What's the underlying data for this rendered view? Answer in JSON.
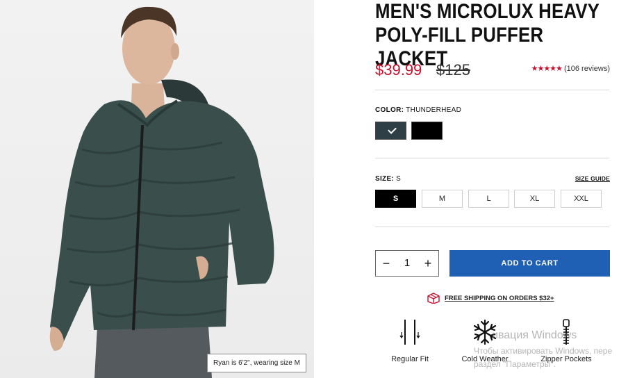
{
  "product": {
    "title": "MEN'S MICROLUX HEAVY POLY-FILL PUFFER JACKET",
    "price_sale": "$39.99",
    "price_original": "$125",
    "stars": "★★★★★",
    "reviews": "(106 reviews)"
  },
  "photo": {
    "caption": "Ryan is 6'2\", wearing size M"
  },
  "color": {
    "label": "COLOR:",
    "value": "THUNDERHEAD",
    "swatches": [
      {
        "name": "thunderhead",
        "hex": "#2f3f46",
        "selected": true
      },
      {
        "name": "black",
        "hex": "#000000",
        "selected": false
      }
    ]
  },
  "size": {
    "label": "SIZE:",
    "value": "S",
    "guide": "SIZE GUIDE",
    "options": [
      "S",
      "M",
      "L",
      "XL",
      "XXL"
    ],
    "selected": "S"
  },
  "cart": {
    "qty_minus": "−",
    "qty_value": "1",
    "qty_plus": "+",
    "add_label": "ADD TO CART"
  },
  "shipping": {
    "text": "FREE SHIPPING ON ORDERS $32+",
    "icon": "box-icon"
  },
  "features": [
    {
      "label": "Regular Fit",
      "icon": "regular-fit-icon"
    },
    {
      "label": "Cold Weather",
      "icon": "snowflake-icon"
    },
    {
      "label": "Zipper Pockets",
      "icon": "zipper-icon"
    }
  ],
  "watermark": {
    "line1": "ивация Windows",
    "line2": "Чтобы активировать Windows, пере",
    "line3": "раздел \"Параметры\"."
  },
  "colors": {
    "sale_red": "#c8102e",
    "cart_blue": "#1f5fb4",
    "jacket_green": "#3a4f4c"
  }
}
